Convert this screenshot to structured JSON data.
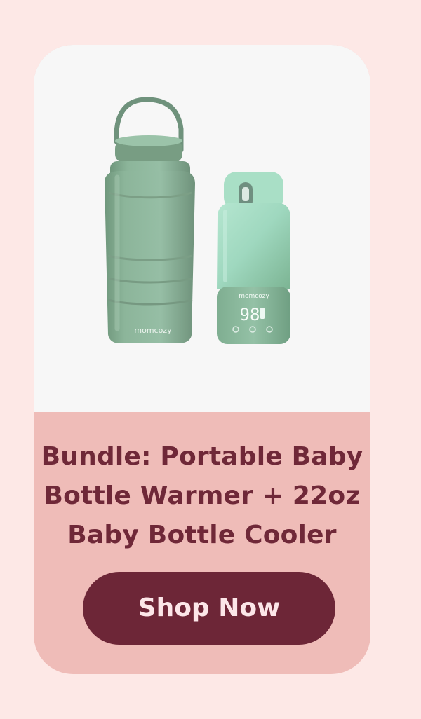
{
  "product": {
    "title": "Bundle: Portable Baby\nBottle Warmer + 22oz\nBaby Bottle Cooler",
    "image": {
      "cooler_brand": "momcozy",
      "warmer_brand": "momcozy",
      "warmer_display": "98"
    }
  },
  "cta": {
    "label": "Shop Now"
  },
  "colors": {
    "page_background": "#fde8e6",
    "card_background": "#efbcb8",
    "image_background": "#f7f7f7",
    "title_text": "#6f2838",
    "button_background": "#6d2637",
    "button_text": "#fce6e8",
    "product_green": "#8fb59c"
  }
}
